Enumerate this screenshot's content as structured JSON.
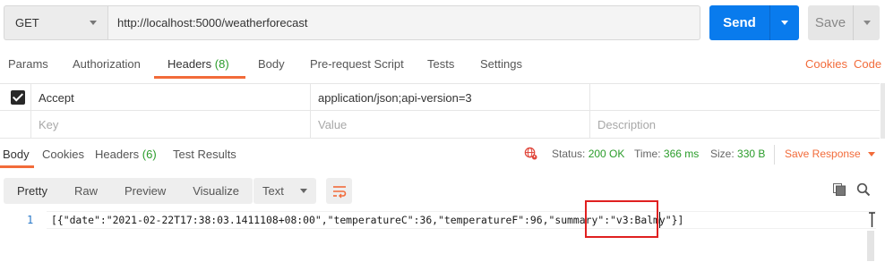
{
  "request": {
    "method": "GET",
    "url": "http://localhost:5000/weatherforecast",
    "send_label": "Send",
    "save_label": "Save"
  },
  "request_tabs": [
    {
      "label": "Params"
    },
    {
      "label": "Authorization"
    },
    {
      "label": "Headers",
      "count": "(8)",
      "active": true
    },
    {
      "label": "Body"
    },
    {
      "label": "Pre-request Script"
    },
    {
      "label": "Tests"
    },
    {
      "label": "Settings"
    }
  ],
  "request_links": {
    "cookies": "Cookies",
    "code": "Code"
  },
  "headers_table": {
    "rows": [
      {
        "checked": true,
        "key": "Accept",
        "value": "application/json;api-version=3",
        "description": ""
      }
    ],
    "placeholders": {
      "key": "Key",
      "value": "Value",
      "description": "Description"
    }
  },
  "response_tabs": [
    {
      "label": "Body",
      "active": true
    },
    {
      "label": "Cookies"
    },
    {
      "label": "Headers",
      "count": "(6)"
    },
    {
      "label": "Test Results"
    }
  ],
  "response_meta": {
    "status_label": "Status:",
    "status_value": "200 OK",
    "time_label": "Time:",
    "time_value": "366 ms",
    "size_label": "Size:",
    "size_value": "330 B",
    "save_response": "Save Response"
  },
  "format_buttons": [
    "Pretty",
    "Raw",
    "Preview",
    "Visualize"
  ],
  "format_select": "Text",
  "code": {
    "line_number": "1",
    "text": "[{\"date\":\"2021-02-22T17:38:03.1411108+08:00\",\"temperatureC\":36,\"temperatureF\":96,\"summary\":\"v3:Balmy\"}]"
  },
  "colors": {
    "accent": "#f26b3a",
    "send": "#097bed",
    "ok": "#2a9c2a",
    "highlight": "#e02020"
  }
}
